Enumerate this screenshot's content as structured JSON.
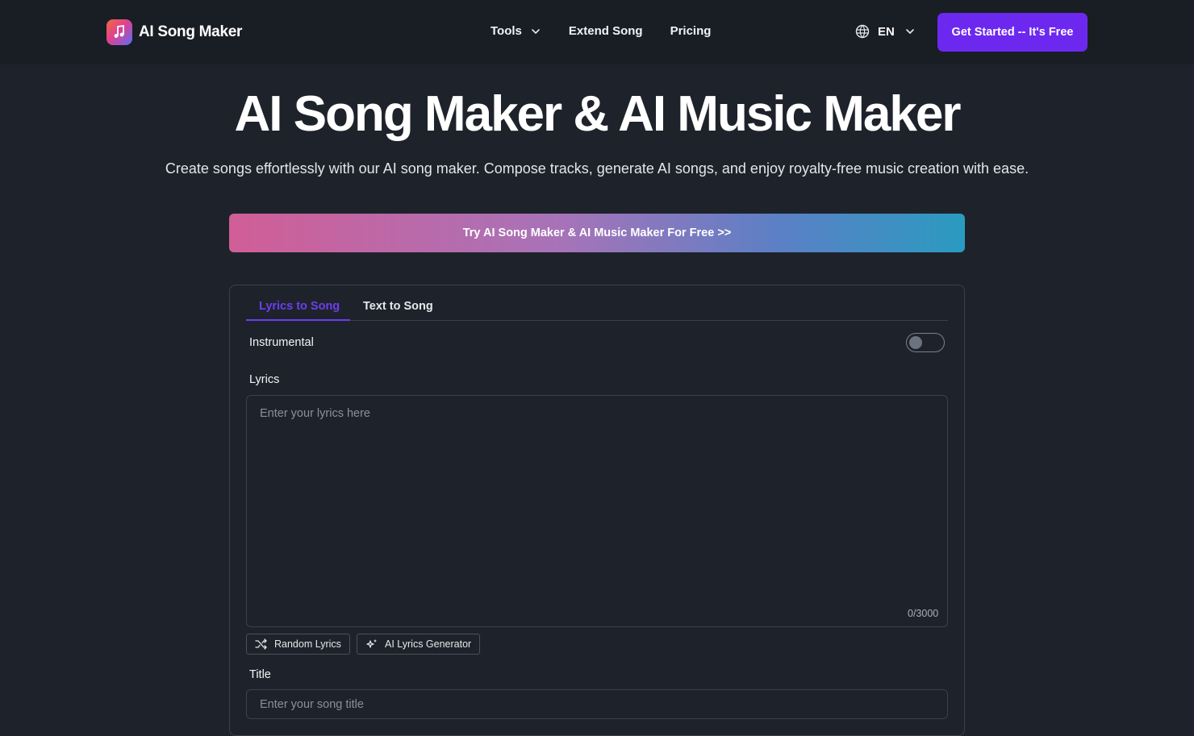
{
  "header": {
    "brand": "AI Song Maker",
    "nav": [
      {
        "label": "Tools",
        "has_dropdown": true
      },
      {
        "label": "Extend Song",
        "has_dropdown": false
      },
      {
        "label": "Pricing",
        "has_dropdown": false
      }
    ],
    "language": "EN",
    "cta_label": "Get Started -- It's Free",
    "icons": {
      "logo": "music-note-icon",
      "language": "globe-icon",
      "dropdown": "chevron-down-icon"
    }
  },
  "hero": {
    "title": "AI Song Maker & AI Music Maker",
    "subtitle": "Create songs effortlessly with our AI song maker. Compose tracks, generate AI songs, and enjoy royalty-free music creation with ease.",
    "try_button": "Try AI Song Maker & AI Music Maker For Free >>"
  },
  "panel": {
    "tabs": [
      {
        "label": "Lyrics to Song",
        "active": true
      },
      {
        "label": "Text to Song",
        "active": false
      }
    ],
    "instrumental_label": "Instrumental",
    "instrumental_on": false,
    "lyrics_label": "Lyrics",
    "lyrics_placeholder": "Enter your lyrics here",
    "lyrics_counter": "0/3000",
    "random_lyrics_label": "Random Lyrics",
    "ai_lyrics_label": "AI Lyrics Generator",
    "title_label": "Title",
    "title_placeholder": "Enter your song title"
  },
  "colors": {
    "background": "#1e232b",
    "header_background": "#191d24",
    "accent": "#6d28f0",
    "border": "#3a414c"
  }
}
